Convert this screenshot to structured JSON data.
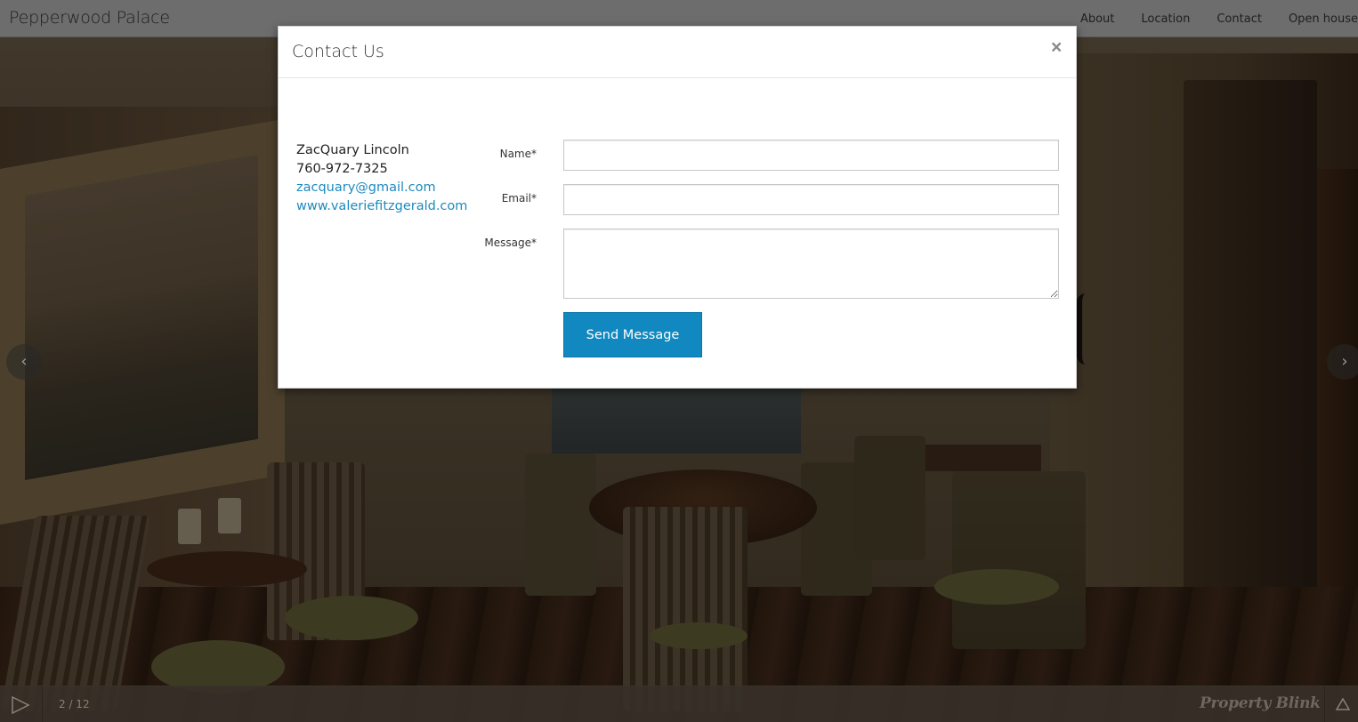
{
  "navbar": {
    "brand": "Pepperwood Palace",
    "links": [
      "About",
      "Location",
      "Contact",
      "Open house"
    ]
  },
  "slideshow": {
    "counter": "2 / 12",
    "prev_icon": "chevron-left-icon",
    "next_icon": "chevron-right-icon",
    "play_icon": "play-icon",
    "expand_icon": "triangle-up-icon",
    "logo": "Property Blink"
  },
  "modal": {
    "title": "Contact Us",
    "close_label": "×",
    "agent": {
      "name": "ZacQuary Lincoln",
      "phone": "760-972-7325",
      "email": "zacquary@gmail.com",
      "website": "www.valeriefitzgerald.com"
    },
    "form": {
      "name_label": "Name*",
      "name_value": "",
      "email_label": "Email*",
      "email_value": "",
      "message_label": "Message*",
      "message_value": "",
      "submit_label": "Send Message"
    }
  },
  "colors": {
    "accent": "#1188c0",
    "link": "#1d8ac0",
    "navbar": "#6d6d6d"
  }
}
